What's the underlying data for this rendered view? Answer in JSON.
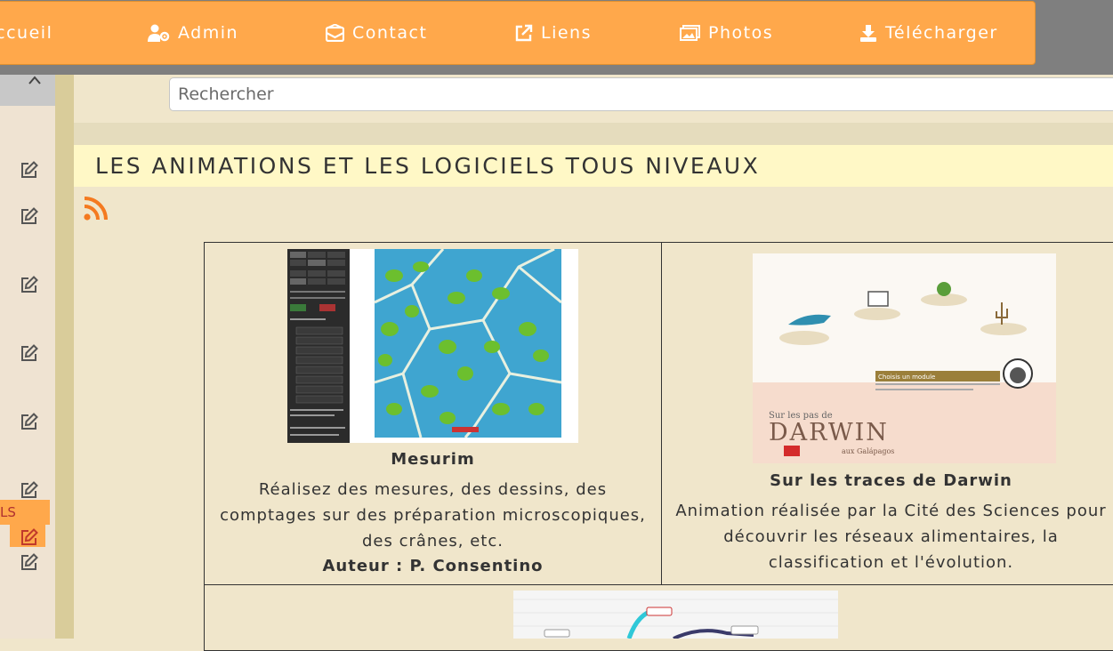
{
  "nav": {
    "items": [
      {
        "label": "Accueil",
        "icon": "home-icon"
      },
      {
        "label": "Admin",
        "icon": "user-gear-icon"
      },
      {
        "label": "Contact",
        "icon": "envelope-icon"
      },
      {
        "label": "Liens",
        "icon": "external-link-icon"
      },
      {
        "label": "Photos",
        "icon": "images-icon"
      },
      {
        "label": "Télécharger",
        "icon": "download-icon"
      }
    ],
    "accent": "#ffa84b"
  },
  "sidebar": {
    "caret_icon": "chevron-up-icon",
    "edit_icon": "edit-icon",
    "active_label": "LS"
  },
  "search": {
    "placeholder": "Rechercher"
  },
  "page": {
    "heading": "LES ANIMATIONS ET LES LOGICIELS TOUS NIVEAUX",
    "rss_icon": "rss-icon"
  },
  "cards": [
    {
      "title": "Mesurim",
      "desc_lines": [
        "Réalisez des mesures, des dessins, des",
        "comptages sur des préparation microscopiques,",
        "des crânes, etc."
      ],
      "author": "Auteur : P.  Consentino"
    },
    {
      "title": "Sur les traces de Darwin",
      "desc_lines": [
        "Animation réalisée par la Cité des Sciences pour",
        "découvrir les réseaux alimentaires, la",
        "classification et l'évolution."
      ],
      "image_text": {
        "line1": "Sur les pas de",
        "line2": "DARWIN",
        "line3": "aux Galápagos",
        "module": "Choisis un module"
      }
    }
  ]
}
